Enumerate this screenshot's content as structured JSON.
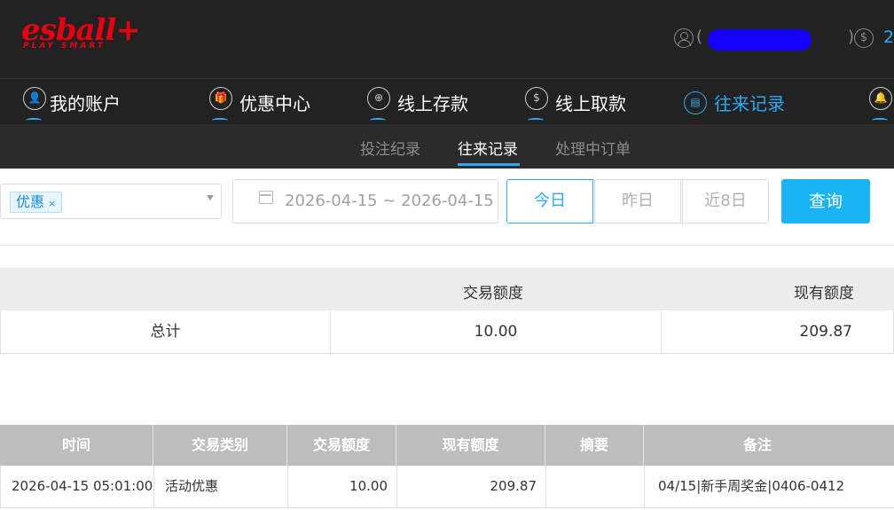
{
  "header": {
    "logo_main": "esball+",
    "logo_sub": "PLAY SMART",
    "balance": "2"
  },
  "nav": [
    {
      "label": "我的账户",
      "icon": "user-icon"
    },
    {
      "label": "优惠中心",
      "icon": "gift-icon"
    },
    {
      "label": "线上存款",
      "icon": "deposit-icon"
    },
    {
      "label": "线上取款",
      "icon": "withdraw-icon"
    },
    {
      "label": "往来记录",
      "icon": "records-icon",
      "active": true
    },
    {
      "label": "",
      "icon": "bell-icon"
    }
  ],
  "subnav": [
    {
      "label": "投注纪录"
    },
    {
      "label": "往来记录",
      "active": true
    },
    {
      "label": "处理中订单"
    }
  ],
  "filter": {
    "selected_tag": "优惠",
    "tag_close": "×",
    "date_range": "2026-04-15 ~ 2026-04-15",
    "quick": [
      "今日",
      "昨日",
      "近8日"
    ],
    "query_label": "查询"
  },
  "summary": {
    "headers": [
      "",
      "交易额度",
      "现有额度"
    ],
    "row": [
      "总计",
      "10.00",
      "209.87"
    ]
  },
  "detail": {
    "headers": [
      "时间",
      "交易类别",
      "交易额度",
      "现有额度",
      "摘要",
      "备注"
    ],
    "rows": [
      [
        "2026-04-15 05:01:00",
        "活动优惠",
        "10.00",
        "209.87",
        "",
        "04/15|新手周奖金|0406-0412"
      ]
    ]
  },
  "colors": {
    "header_bg": "#222222",
    "accent": "#2ea8f5",
    "brand": "#e60012"
  }
}
